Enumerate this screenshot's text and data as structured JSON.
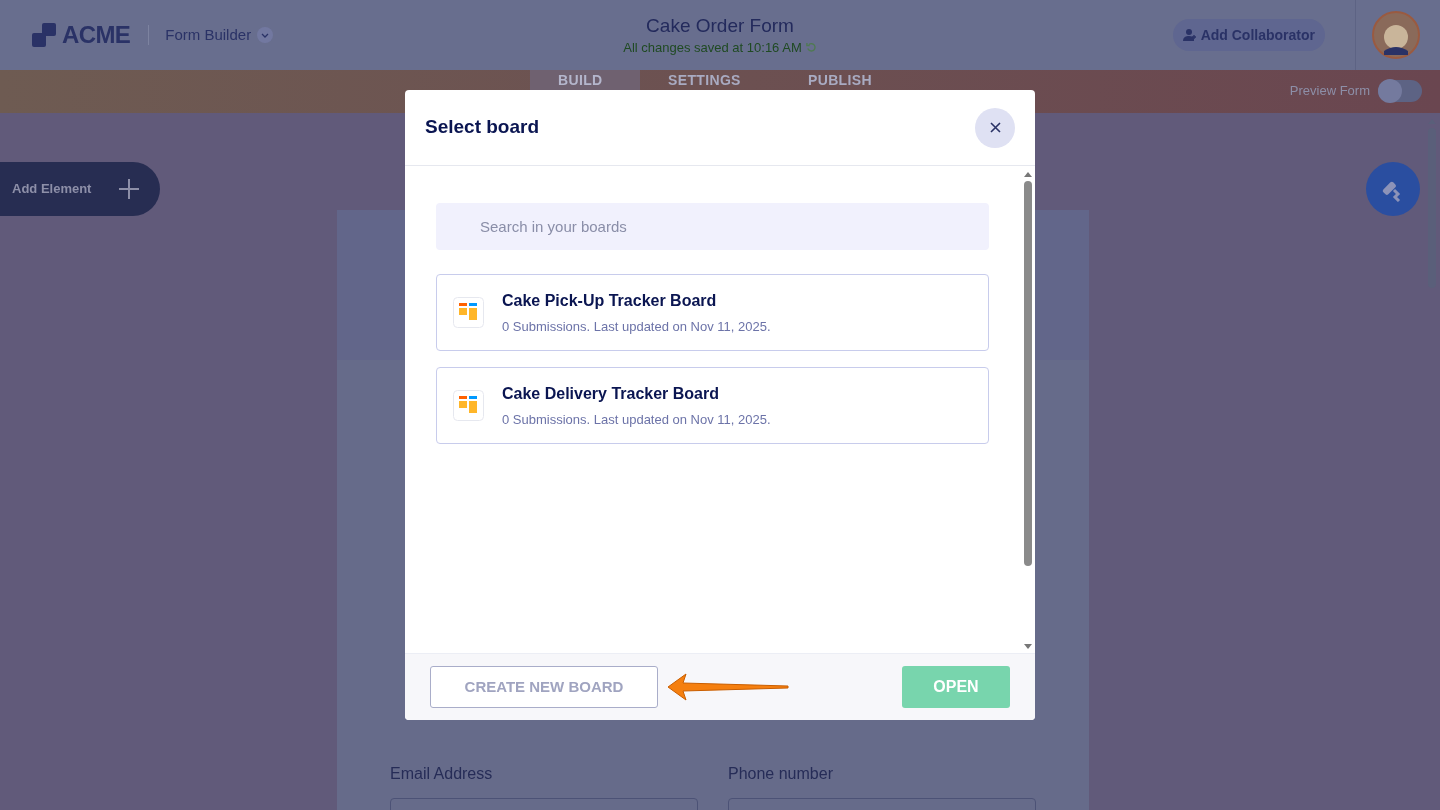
{
  "header": {
    "logo": "ACME",
    "app_menu": "Form Builder",
    "form_title": "Cake Order Form",
    "save_status": "All changes saved at 10:16 AM",
    "collaborator_button": "Add Collaborator"
  },
  "tabs": [
    {
      "label": "BUILD",
      "selected": true
    },
    {
      "label": "SETTINGS",
      "selected": false
    },
    {
      "label": "PUBLISH",
      "selected": false
    }
  ],
  "preview_toggle": {
    "label": "Preview Form",
    "on": false
  },
  "add_element_button": "Add Element",
  "form_fields": [
    {
      "label": "Email Address"
    },
    {
      "label": "Phone number"
    }
  ],
  "dialog": {
    "title": "Select board",
    "search": {
      "placeholder": "Search in your boards"
    },
    "boards": [
      {
        "name": "Cake Pick-Up Tracker Board",
        "meta": "0 Submissions. Last updated on Nov 11, 2025."
      },
      {
        "name": "Cake Delivery Tracker Board",
        "meta": "0 Submissions. Last updated on Nov 11, 2025."
      }
    ],
    "create_button": "CREATE NEW BOARD",
    "open_button": {
      "label": "OPEN",
      "disabled": true
    }
  }
}
